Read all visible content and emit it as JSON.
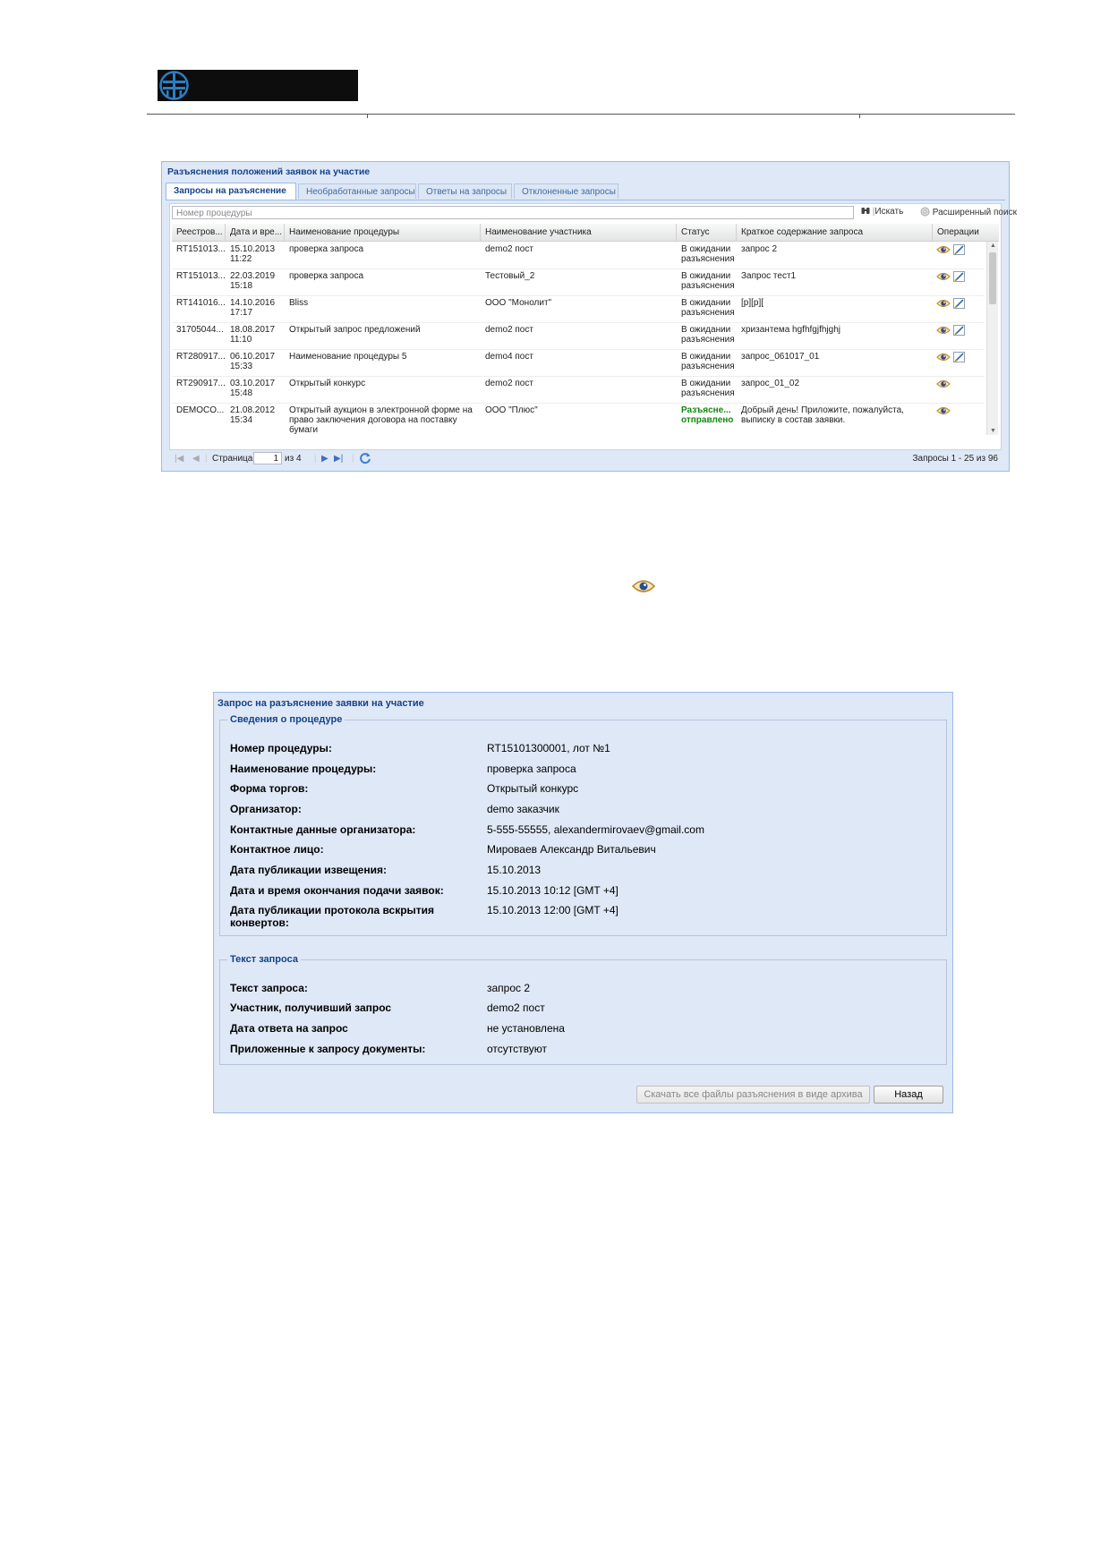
{
  "header": {
    "logo_alt": "logo"
  },
  "panel1": {
    "title": "Разъяснения положений заявок на участие",
    "tabs": [
      "Запросы на разъяснение",
      "Необработанные запросы",
      "Ответы на запросы",
      "Отклоненные запросы"
    ],
    "search": {
      "placeholder": "Номер процедуры",
      "search_label": "Искать",
      "advanced_label": "Расширенный поиск"
    },
    "columns": [
      "Реестров...",
      "Дата и вре...",
      "Наименование процедуры",
      "Наименование участника",
      "Статус",
      "Краткое содержание запроса",
      "Операции"
    ],
    "rows": [
      {
        "reg": "RT151013...",
        "date": "15.10.2013",
        "time": "11:22",
        "proc": [
          "проверка запроса"
        ],
        "participant": "demo2 пост",
        "status": [
          "В ожидании",
          "разъяснения"
        ],
        "status_ok": false,
        "summary": [
          "запрос 2"
        ],
        "ops": [
          "eye-icon",
          "edit-icon"
        ]
      },
      {
        "reg": "RT151013...",
        "date": "22.03.2019",
        "time": "15:18",
        "proc": [
          "проверка запроса"
        ],
        "participant": "Тестовый_2",
        "status": [
          "В ожидании",
          "разъяснения"
        ],
        "status_ok": false,
        "summary": [
          "Запрос тест1"
        ],
        "ops": [
          "eye-icon",
          "edit-icon"
        ]
      },
      {
        "reg": "RT141016...",
        "date": "14.10.2016",
        "time": "17:17",
        "proc": [
          "Bliss"
        ],
        "participant": "ООО \"Монолит\"",
        "status": [
          "В ожидании",
          "разъяснения"
        ],
        "status_ok": false,
        "summary": [
          "[p][p]["
        ],
        "ops": [
          "eye-icon",
          "edit-icon"
        ]
      },
      {
        "reg": "31705044...",
        "date": "18.08.2017",
        "time": "11:10",
        "proc": [
          "Открытый запрос предложений"
        ],
        "participant": "demo2 пост",
        "status": [
          "В ожидании",
          "разъяснения"
        ],
        "status_ok": false,
        "summary": [
          "хризантема hgfhfgjfhjghj"
        ],
        "ops": [
          "eye-icon",
          "edit-icon"
        ]
      },
      {
        "reg": "RT280917...",
        "date": "06.10.2017",
        "time": "15:33",
        "proc": [
          "Наименование процедуры 5"
        ],
        "participant": "demo4 пост",
        "status": [
          "В ожидании",
          "разъяснения"
        ],
        "status_ok": false,
        "summary": [
          "запрос_061017_01"
        ],
        "ops": [
          "eye-icon",
          "edit-icon"
        ]
      },
      {
        "reg": "RT290917...",
        "date": "03.10.2017",
        "time": "15:48",
        "proc": [
          "Открытый конкурс"
        ],
        "participant": "demo2 пост",
        "status": [
          "В ожидании",
          "разъяснения"
        ],
        "status_ok": false,
        "summary": [
          "запрос_01_02"
        ],
        "ops": [
          "eye-icon"
        ]
      },
      {
        "reg": "DEMOCO...",
        "date": "21.08.2012",
        "time": "15:34",
        "proc": [
          "Открытый аукцион в электронной форме на",
          "право заключения договора на поставку",
          "бумаги"
        ],
        "participant": "ООО \"Плюс\"",
        "status": [
          "Разъясне...",
          "отправлено"
        ],
        "status_ok": true,
        "summary": [
          "Добрый день! Приложите, пожалуйста,",
          "выписку в состав заявки."
        ],
        "ops": [
          "eye-icon"
        ]
      }
    ],
    "pager": {
      "page_label": "Страница",
      "page": "1",
      "of_label": "из 4",
      "summary": "Запросы 1 - 25 из 96"
    }
  },
  "panel2": {
    "title": "Запрос на разъяснение заявки на участие",
    "section1": {
      "legend": "Сведения о процедуре",
      "fields": [
        {
          "label": "Номер процедуры:",
          "value": "RT15101300001, лот №1"
        },
        {
          "label": "Наименование процедуры:",
          "value": "проверка запроса"
        },
        {
          "label": "Форма торгов:",
          "value": "Открытый конкурс"
        },
        {
          "label": "Организатор:",
          "value": "demo заказчик"
        },
        {
          "label": "Контактные данные организатора:",
          "value": "5-555-55555, alexandermirovaev@gmail.com"
        },
        {
          "label": "Контактное лицо:",
          "value": "Мироваев Александр Витальевич"
        },
        {
          "label": "Дата публикации извещения:",
          "value": "15.10.2013"
        },
        {
          "label": "Дата и время окончания подачи заявок:",
          "value": "15.10.2013 10:12 [GMT +4]"
        },
        {
          "label": "Дата публикации протокола вскрытия",
          "label2": "конвертов:",
          "value": "15.10.2013 12:00 [GMT +4]"
        }
      ]
    },
    "section2": {
      "legend": "Текст запроса",
      "fields": [
        {
          "label": "Текст запроса:",
          "value": "запрос 2"
        },
        {
          "label": "Участник, получивший запрос",
          "value": "demo2 пост"
        },
        {
          "label": "Дата ответа на запрос",
          "value": "не установлена"
        },
        {
          "label": "Приложенные к запросу документы:",
          "value": "отсутствуют"
        }
      ]
    },
    "buttons": {
      "download_all": "Скачать все файлы разъяснения в виде архива",
      "back": "Назад"
    }
  }
}
